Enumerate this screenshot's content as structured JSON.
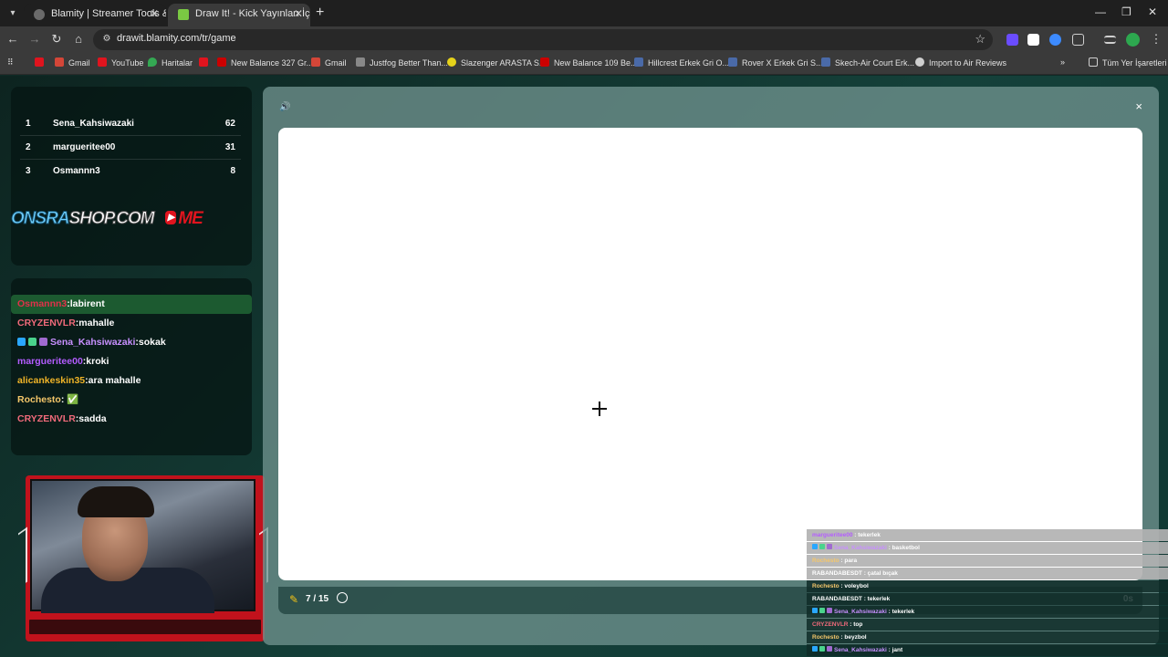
{
  "browser": {
    "tabs": [
      {
        "title": "Blamity | Streamer Tools & Partn",
        "active": false
      },
      {
        "title": "Draw It! - Kick Yayınları İçin Çiz",
        "active": true
      }
    ],
    "url": "drawit.blamity.com/tr/game",
    "bookmarks": [
      "Gmail",
      "YouTube",
      "Haritalar",
      "New Balance 327 Gr...",
      "Gmail",
      "Justfog Better Than...",
      "Slazenger ARASTA S...",
      "New Balance 109 Be...",
      "Hillcrest Erkek Gri O...",
      "Rover X Erkek Gri S...",
      "Skech-Air Court Erk...",
      "Import to Air Reviews"
    ],
    "all_bookmarks": "Tüm Yer İşaretleri",
    "colors": {
      "chrome_dark": "#1f1f1f",
      "chrome_mid": "#3a3a3a"
    }
  },
  "leaderboard": [
    {
      "rank": "1",
      "name": "Sena_Kahsiwazaki",
      "score": "62"
    },
    {
      "rank": "2",
      "name": "margueritee00",
      "score": "31"
    },
    {
      "rank": "3",
      "name": "Osmannn3",
      "score": "8"
    }
  ],
  "banner": {
    "part1": "ONSRA",
    "part2": "SHOP.COM",
    "yt": "▶",
    "me": "ME"
  },
  "chat": [
    {
      "user": "Osmannn3",
      "msg": ":labirent",
      "color": "#e0314a",
      "highlight": true
    },
    {
      "user": "CRYZENVLR",
      "msg": ":mahalle",
      "color": "#f06a7a",
      "highlight": false
    },
    {
      "user": "Sena_Kahsiwazaki",
      "msg": ":sokak",
      "color": "#c890ff",
      "highlight": false
    },
    {
      "user": "margueritee00",
      "msg": ":kroki",
      "color": "#b45cff",
      "highlight": false
    },
    {
      "user": "alicankeskin35",
      "msg": ":ara mahalle",
      "color": "#f0b428",
      "highlight": false
    },
    {
      "user": "Rochesto",
      "msg": ": ✅",
      "color": "#f5c76a",
      "highlight": false
    },
    {
      "user": "CRYZENVLR",
      "msg": ":sadda",
      "color": "#f06a7a",
      "highlight": false
    }
  ],
  "game": {
    "round": "7 / 15",
    "timer": "0s",
    "close": "×"
  },
  "overlay_chat": [
    {
      "user": "margueritee00",
      "msg": " : tekerlek",
      "color": "#b45cff",
      "dark": false
    },
    {
      "user": "Sena_Kahsiwazaki",
      "msg": " : basketbol",
      "color": "#c890ff",
      "dark": false
    },
    {
      "user": "Rochesto",
      "msg": " : para",
      "color": "#f5c76a",
      "dark": false
    },
    {
      "user": "RABANDABESDT",
      "msg": " : çatal bıçak",
      "color": "#ffffff",
      "dark": false
    },
    {
      "user": "Rochesto",
      "msg": " : voleybol",
      "color": "#f5c76a",
      "dark": true
    },
    {
      "user": "RABANDABESDT",
      "msg": " : tekerlek",
      "color": "#ffffff",
      "dark": true
    },
    {
      "user": "Sena_Kahsiwazaki",
      "msg": " : tekerlek",
      "color": "#c890ff",
      "dark": true
    },
    {
      "user": "CRYZENVLR",
      "msg": " : top",
      "color": "#f06a7a",
      "dark": true
    },
    {
      "user": "Rochesto",
      "msg": " : beyzbol",
      "color": "#f5c76a",
      "dark": true
    },
    {
      "user": "Sena_Kahsiwazaki",
      "msg": " : jant",
      "color": "#c890ff",
      "dark": true
    }
  ]
}
